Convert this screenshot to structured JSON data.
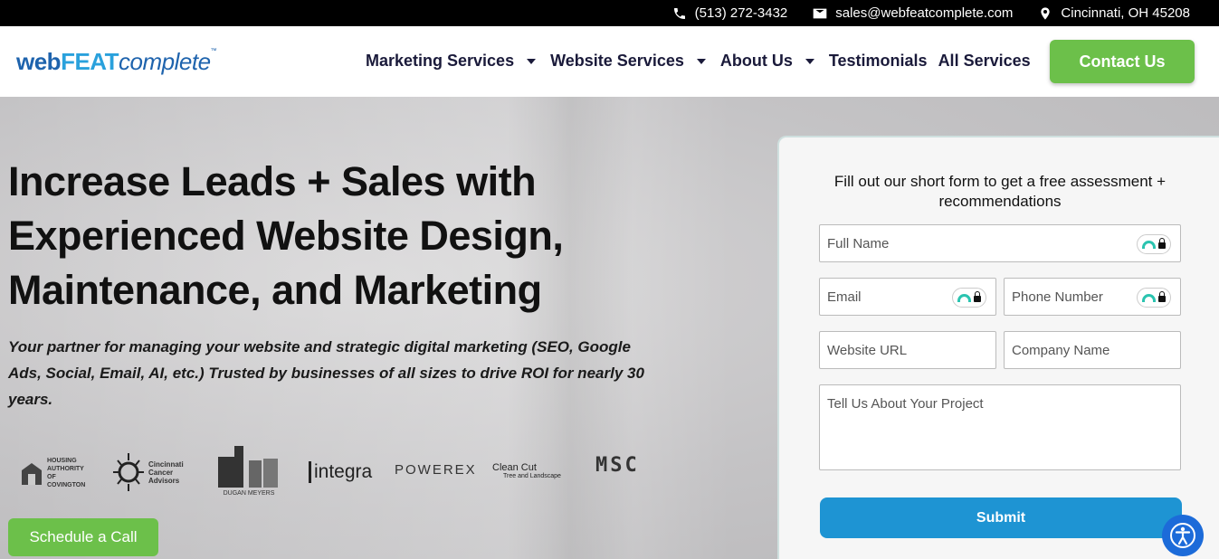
{
  "topbar": {
    "phone": "(513) 272-3432",
    "email": "sales@webfeatcomplete.com",
    "location": "Cincinnati, OH 45208",
    "phone_icon": "phone-icon",
    "email_icon": "envelope-icon",
    "location_icon": "map-pin-icon"
  },
  "logo": {
    "web": "web",
    "feat": "FEAT",
    "complete": "complete",
    "tm": "™"
  },
  "nav": {
    "items": [
      {
        "label": "Marketing Services",
        "has_dropdown": true
      },
      {
        "label": "Website Services",
        "has_dropdown": true
      },
      {
        "label": "About Us",
        "has_dropdown": true
      },
      {
        "label": "Testimonials",
        "has_dropdown": false
      },
      {
        "label": "All Services",
        "has_dropdown": false
      }
    ],
    "contact_label": "Contact Us"
  },
  "hero": {
    "headline_1": "Increase Leads + Sales with",
    "headline_2": "Experienced Website Design,",
    "headline_3": "Maintenance, and Marketing",
    "subtext": "Your partner for managing your website and strategic digital marketing (SEO, Google Ads, Social, Email, AI, etc.) Trusted by businesses of all sizes to drive ROI for nearly 30 years.",
    "schedule_label": "Schedule a Call"
  },
  "client_logos": [
    {
      "name": "HOUSING AUTHORITY OF COVINGTON"
    },
    {
      "name": "Cincinnati Cancer Advisors"
    },
    {
      "name": "DUGAN MEYERS"
    },
    {
      "name": "integra"
    },
    {
      "name": "POWEREX"
    },
    {
      "name": "Clean Cut",
      "tagline": "Tree and Landscape"
    },
    {
      "name": "MSC"
    }
  ],
  "form": {
    "title": "Fill out our short form to get a free assessment + recommendations",
    "full_name": "Full Name",
    "email": "Email",
    "phone": "Phone Number",
    "website": "Website URL",
    "company": "Company Name",
    "project": "Tell Us About Your Project",
    "submit": "Submit"
  },
  "colors": {
    "accent_green": "#6cc04a",
    "submit_blue": "#1e94d3",
    "logo_blue": "#1e63ad",
    "nav_text": "#1a1a3a"
  }
}
